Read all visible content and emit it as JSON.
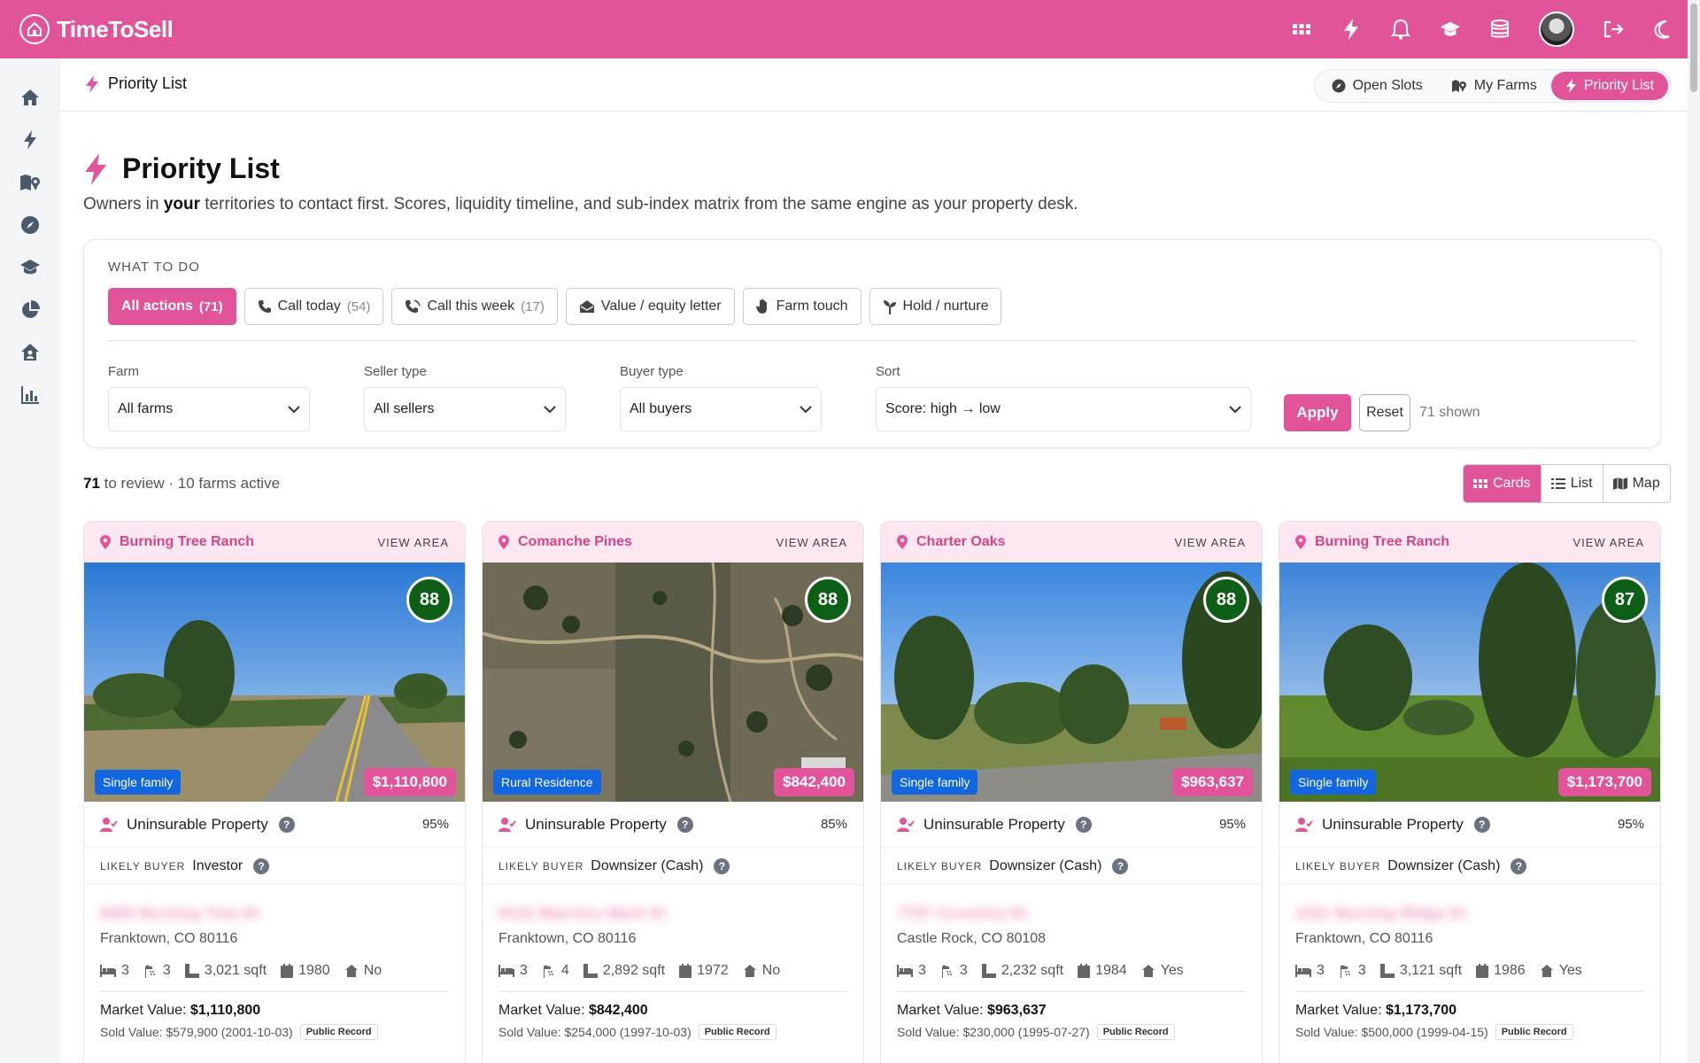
{
  "app": {
    "name": "TimeToSell"
  },
  "subheader": {
    "title": "Priority List",
    "tabs": [
      {
        "label": "Open Slots",
        "icon": "compass-icon"
      },
      {
        "label": "My Farms",
        "icon": "map-icon"
      },
      {
        "label": "Priority List",
        "icon": "bolt-icon",
        "active": true
      }
    ]
  },
  "page": {
    "title": "Priority List",
    "subtitle_pre": "Owners in ",
    "subtitle_bold": "your",
    "subtitle_post": " territories to contact first. Scores, liquidity timeline, and sub-index matrix from the same engine as your property desk."
  },
  "filters": {
    "section_label": "WHAT TO DO",
    "actions": [
      {
        "label": "All actions",
        "count": "(71)",
        "active": true
      },
      {
        "label": "Call today",
        "count": "(54)"
      },
      {
        "label": "Call this week",
        "count": "(17)"
      },
      {
        "label": "Value / equity letter",
        "count": ""
      },
      {
        "label": "Farm touch",
        "count": ""
      },
      {
        "label": "Hold / nurture",
        "count": ""
      }
    ],
    "farm_label": "Farm",
    "farm_value": "All farms",
    "seller_label": "Seller type",
    "seller_value": "All sellers",
    "buyer_label": "Buyer type",
    "buyer_value": "All buyers",
    "sort_label": "Sort",
    "sort_value": "Score: high → low",
    "apply": "Apply",
    "reset": "Reset",
    "shown": "71 shown"
  },
  "summary": {
    "count": "71",
    "text": " to review · 10 farms active"
  },
  "views": [
    {
      "label": "Cards",
      "active": true
    },
    {
      "label": "List"
    },
    {
      "label": "Map"
    }
  ],
  "cards": [
    {
      "farm": "Burning Tree Ranch",
      "view_area": "VIEW AREA",
      "score": "88",
      "type": "Single family",
      "price": "$1,110,800",
      "seller": "Uninsurable Property",
      "seller_pct": "95%",
      "buyer_cap": "LIKELY BUYER",
      "buyer": "Investor",
      "address": "8404 Burning Tree Dr",
      "city": "Franktown, CO 80116",
      "beds": "3",
      "baths": "3",
      "sqft": "3,021 sqft",
      "year": "1980",
      "hoa": "No",
      "mv_label": "Market Value: ",
      "mv": "$1,110,800",
      "sold": "Sold Value: $579,900 (2001-10-03)",
      "badge": "Public Record"
    },
    {
      "farm": "Comanche Pines",
      "view_area": "VIEW AREA",
      "score": "88",
      "type": "Rural Residence",
      "price": "$842,400",
      "seller": "Uninsurable Property",
      "seller_pct": "85%",
      "buyer_cap": "LIKELY BUYER",
      "buyer": "Downsizer (Cash)",
      "address": "8122 Warriors Mark Dr",
      "city": "Franktown, CO 80116",
      "beds": "3",
      "baths": "4",
      "sqft": "2,892 sqft",
      "year": "1972",
      "hoa": "No",
      "mv_label": "Market Value: ",
      "mv": "$842,400",
      "sold": "Sold Value: $254,000 (1997-10-03)",
      "badge": "Public Record"
    },
    {
      "farm": "Charter Oaks",
      "view_area": "VIEW AREA",
      "score": "88",
      "type": "Single family",
      "price": "$963,637",
      "seller": "Uninsurable Property",
      "seller_pct": "95%",
      "buyer_cap": "LIKELY BUYER",
      "buyer": "Downsizer (Cash)",
      "address": "7767 Coventry Dr",
      "city": "Castle Rock, CO 80108",
      "beds": "3",
      "baths": "3",
      "sqft": "2,232 sqft",
      "year": "1984",
      "hoa": "Yes",
      "mv_label": "Market Value: ",
      "mv": "$963,637",
      "sold": "Sold Value: $230,000 (1995-07-27)",
      "badge": "Public Record"
    },
    {
      "farm": "Burning Tree Ranch",
      "view_area": "VIEW AREA",
      "score": "87",
      "type": "Single family",
      "price": "$1,173,700",
      "seller": "Uninsurable Property",
      "seller_pct": "95%",
      "buyer_cap": "LIKELY BUYER",
      "buyer": "Downsizer (Cash)",
      "address": "2321 Burning Ridge Dr",
      "city": "Franktown, CO 80116",
      "beds": "3",
      "baths": "3",
      "sqft": "3,121 sqft",
      "year": "1986",
      "hoa": "Yes",
      "mv_label": "Market Value: ",
      "mv": "$1,173,700",
      "sold": "Sold Value: $500,000 (1999-04-15)",
      "badge": "Public Record"
    }
  ],
  "colors": {
    "brand": "#e2549a",
    "score": "#0d5e17",
    "type_badge": "#1266e0"
  }
}
